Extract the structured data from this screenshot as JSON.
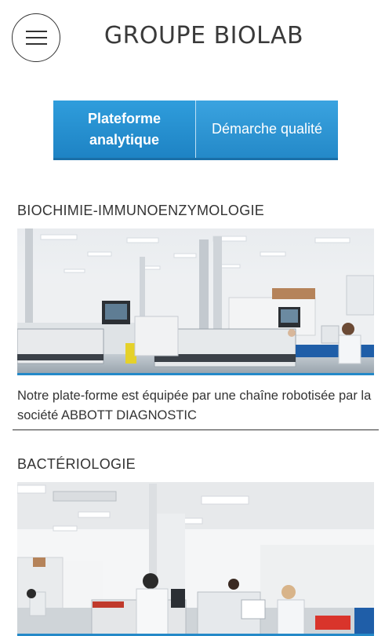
{
  "header": {
    "title": "GROUPE BIOLAB",
    "menu_icon": "hamburger-menu-icon"
  },
  "tabs": [
    {
      "label": "Plateforme analytique",
      "active": true
    },
    {
      "label": "Démarche qualité",
      "active": false
    }
  ],
  "sections": [
    {
      "title": "BIOCHIMIE-IMMUNOENZYMOLOGIE",
      "image": "laboratory-automation-photo",
      "description": "Notre plate-forme est équipée par une chaîne robotisée par la société ABBOTT DIAGNOSTIC"
    },
    {
      "title": "BACTÉRIOLOGIE",
      "image": "bacteriology-lab-photo"
    }
  ],
  "colors": {
    "accent": "#2489c8",
    "accent_dark": "#1a6fa8",
    "text": "#333333"
  }
}
